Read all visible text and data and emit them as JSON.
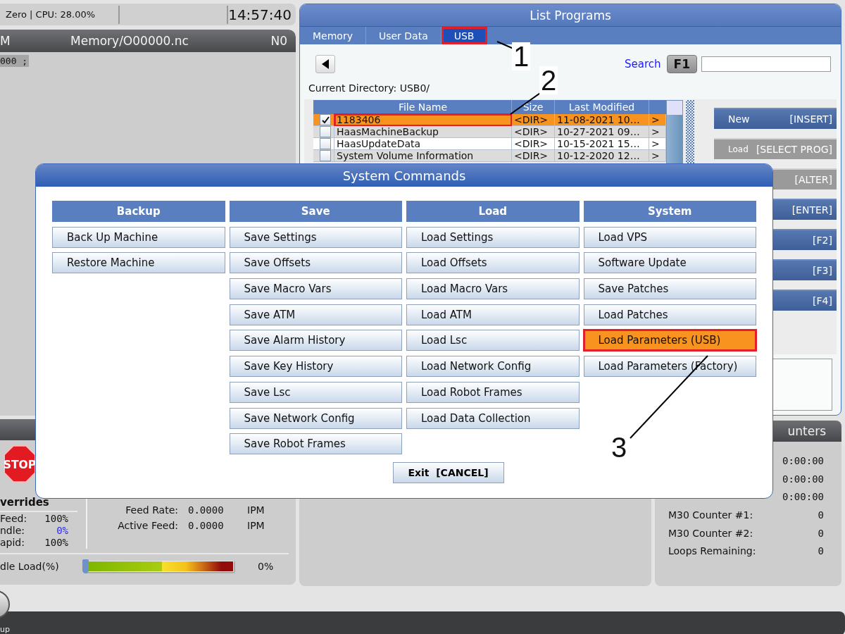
{
  "status_bar": {
    "info": "Zero | CPU: 28.00%",
    "time": "14:57:40"
  },
  "program_panel": {
    "mode": "M",
    "path": "Memory/O00000.nc",
    "line": "N0",
    "code_line": "000 ;"
  },
  "list_programs": {
    "title": "List Programs",
    "tabs": [
      {
        "label": "Memory",
        "selected": false,
        "highlighted": false
      },
      {
        "label": "User Data",
        "selected": false,
        "highlighted": false
      },
      {
        "label": "USB",
        "selected": true,
        "highlighted": true
      }
    ],
    "search_label": "Search",
    "search_key": "F1",
    "current_directory": "Current Directory: USB0/",
    "table": {
      "columns": [
        "File Name",
        "Size",
        "Last Modified"
      ],
      "rows": [
        {
          "checked": true,
          "selected": true,
          "highlighted": true,
          "name": "1183406",
          "size": "<DIR>",
          "modified": "11-08-2021 10…",
          "arrow": ">"
        },
        {
          "checked": false,
          "selected": false,
          "highlighted": false,
          "name": "HaasMachineBackup",
          "size": "<DIR>",
          "modified": "10-27-2021 09…",
          "arrow": ">"
        },
        {
          "checked": false,
          "selected": false,
          "highlighted": false,
          "name": "HaasUpdateData",
          "size": "<DIR>",
          "modified": "10-15-2021 15…",
          "arrow": ">"
        },
        {
          "checked": false,
          "selected": false,
          "highlighted": false,
          "name": "System Volume Information",
          "size": "<DIR>",
          "modified": "10-12-2020 12…",
          "arrow": ">"
        }
      ]
    },
    "buttons": [
      {
        "label": "New",
        "key": "[INSERT]",
        "disabled": false
      },
      {
        "label": "Load",
        "key": "[SELECT PROG]",
        "disabled": true
      },
      {
        "key": "[ALTER]",
        "disabled": true
      },
      {
        "key": "[ENTER]",
        "disabled": false
      },
      {
        "key": "[F2]",
        "disabled": false
      },
      {
        "key": "[F3]",
        "disabled": false
      },
      {
        "key": "[F4]",
        "disabled": false
      }
    ]
  },
  "overrides": {
    "stop_label": "STOP",
    "title": "verrides",
    "rows": [
      {
        "label": "Feed:",
        "value": "100%",
        "color": "#111111"
      },
      {
        "label": "ndle:",
        "value": "0%",
        "color": "#2b2bff"
      },
      {
        "label": "apid:",
        "value": "100%",
        "color": "#111111"
      }
    ],
    "feed_data": [
      {
        "label": "Feed Rate:",
        "value": "0.0000",
        "unit": "IPM"
      },
      {
        "label": "Active Feed:",
        "value": "0.0000",
        "unit": "IPM"
      }
    ],
    "spindle_load": {
      "label": "dle Load(%)",
      "level": 0,
      "reading": "0%"
    }
  },
  "counters": {
    "title": "unters",
    "rows": [
      {
        "value": "0:00:00"
      },
      {
        "value": "0:00:00"
      },
      {
        "value": "0:00:00"
      },
      {
        "label": "M30 Counter #1:",
        "value": "0"
      },
      {
        "label": "M30 Counter #2:",
        "value": "0"
      },
      {
        "label": "Loops Remaining:",
        "value": "0"
      }
    ]
  },
  "footer": {
    "label": "up"
  },
  "dialog": {
    "title": "System Commands",
    "columns": [
      {
        "title": "Backup",
        "items": [
          {
            "label": "Back Up Machine",
            "selected": false,
            "highlighted": false
          },
          {
            "label": "Restore Machine",
            "selected": false,
            "highlighted": false
          }
        ]
      },
      {
        "title": "Save",
        "items": [
          {
            "label": "Save Settings",
            "selected": false,
            "highlighted": false
          },
          {
            "label": "Save Offsets",
            "selected": false,
            "highlighted": false
          },
          {
            "label": "Save Macro Vars",
            "selected": false,
            "highlighted": false
          },
          {
            "label": "Save ATM",
            "selected": false,
            "highlighted": false
          },
          {
            "label": "Save Alarm History",
            "selected": false,
            "highlighted": false
          },
          {
            "label": "Save Key History",
            "selected": false,
            "highlighted": false
          },
          {
            "label": "Save Lsc",
            "selected": false,
            "highlighted": false
          },
          {
            "label": "Save Network Config",
            "selected": false,
            "highlighted": false
          },
          {
            "label": "Save Robot Frames",
            "selected": false,
            "highlighted": false
          }
        ]
      },
      {
        "title": "Load",
        "items": [
          {
            "label": "Load Settings",
            "selected": false,
            "highlighted": false
          },
          {
            "label": "Load Offsets",
            "selected": false,
            "highlighted": false
          },
          {
            "label": "Load Macro Vars",
            "selected": false,
            "highlighted": false
          },
          {
            "label": "Load ATM",
            "selected": false,
            "highlighted": false
          },
          {
            "label": "Load Lsc",
            "selected": false,
            "highlighted": false
          },
          {
            "label": "Load Network Config",
            "selected": false,
            "highlighted": false
          },
          {
            "label": "Load Robot Frames",
            "selected": false,
            "highlighted": false
          },
          {
            "label": "Load Data Collection",
            "selected": false,
            "highlighted": false
          }
        ]
      },
      {
        "title": "System",
        "items": [
          {
            "label": "Load VPS",
            "selected": false,
            "highlighted": false
          },
          {
            "label": "Software Update",
            "selected": false,
            "highlighted": false
          },
          {
            "label": "Save Patches",
            "selected": false,
            "highlighted": false
          },
          {
            "label": "Load Patches",
            "selected": false,
            "highlighted": false
          },
          {
            "label": "Load Parameters (USB)",
            "selected": true,
            "highlighted": true
          },
          {
            "label": "Load Parameters (Factory)",
            "selected": false,
            "highlighted": false
          }
        ]
      }
    ],
    "exit": "Exit  [CANCEL]"
  },
  "callouts": [
    {
      "label": "1"
    },
    {
      "label": "2"
    },
    {
      "label": "3"
    }
  ]
}
